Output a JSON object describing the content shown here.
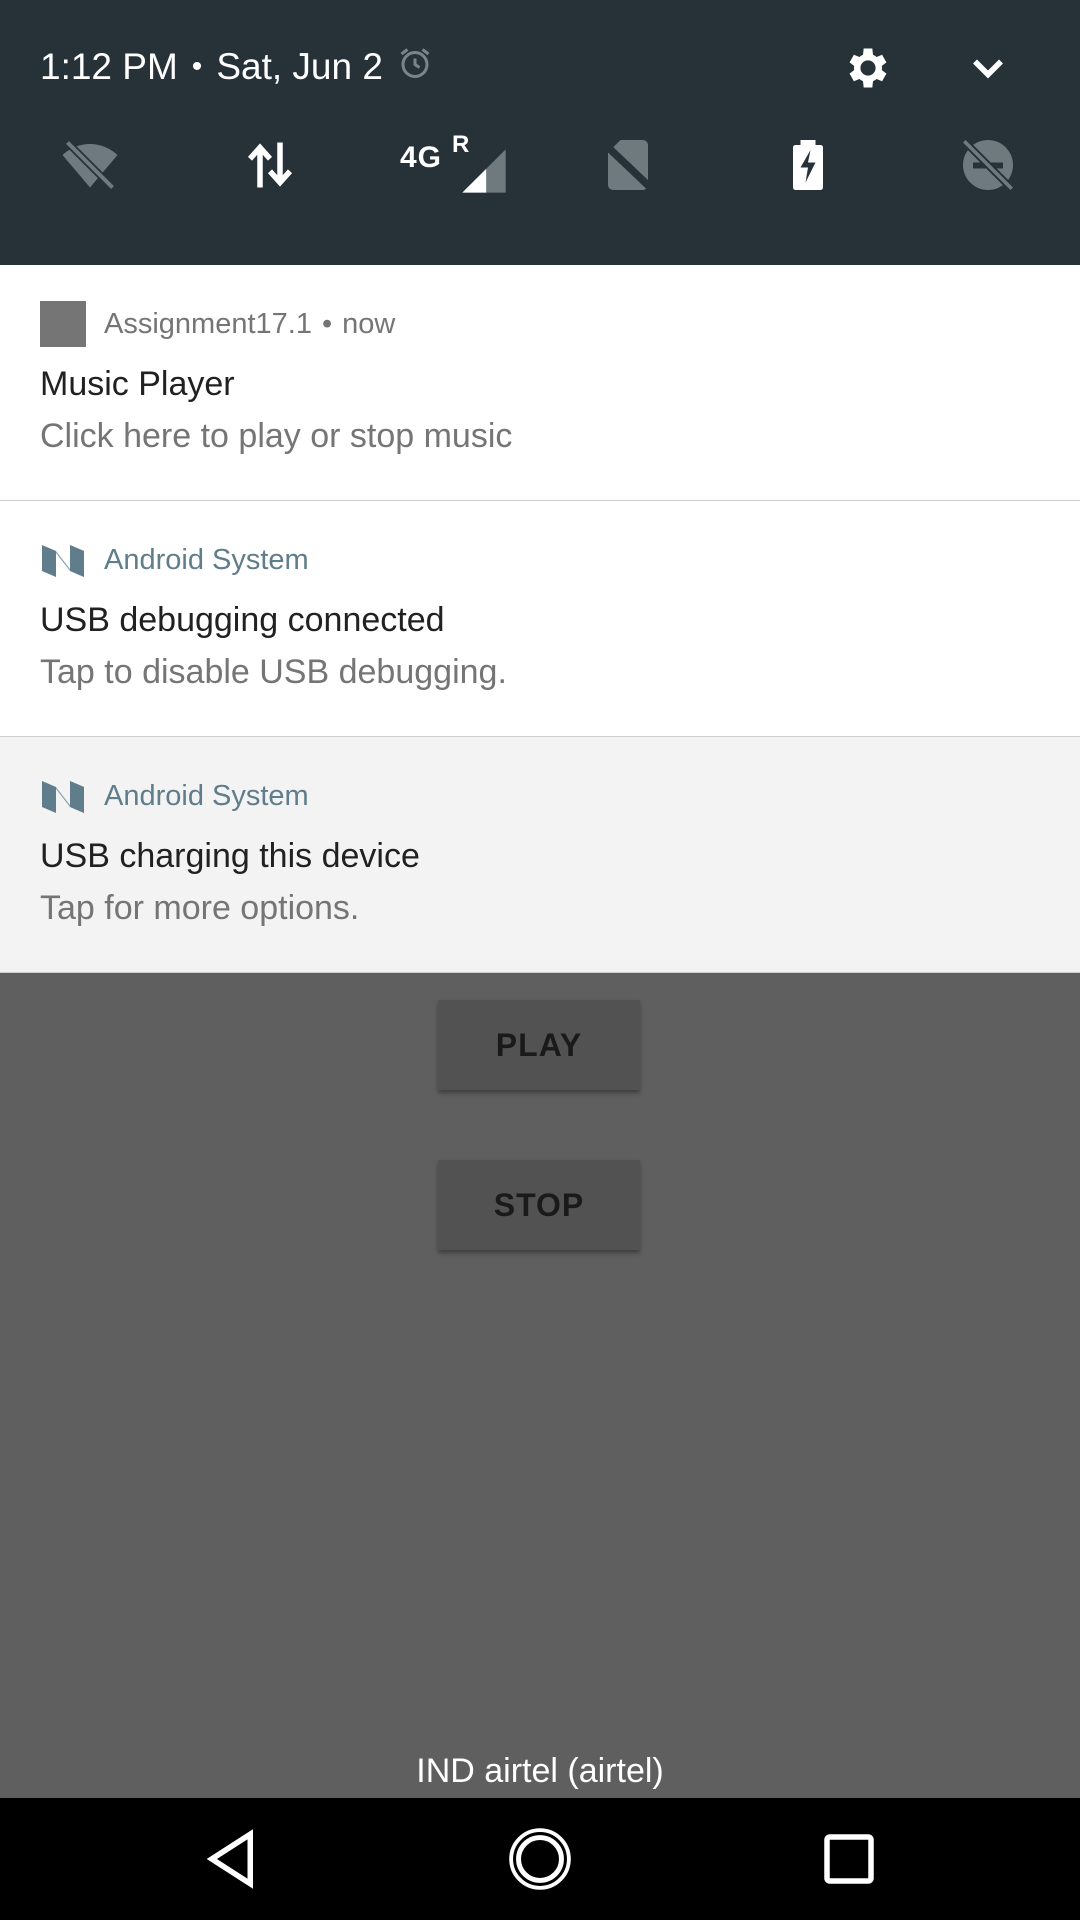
{
  "status": {
    "time": "1:12 PM",
    "separator": "•",
    "date": "Sat, Jun 2",
    "network_label": "4G",
    "roaming_label": "R"
  },
  "notifications": [
    {
      "app": "Assignment17.1",
      "separator": "•",
      "when": "now",
      "title": "Music Player",
      "text": "Click here to play or stop music"
    },
    {
      "app": "Android System",
      "title": "USB debugging connected",
      "text": "Tap to disable USB debugging."
    },
    {
      "app": "Android System",
      "title": "USB charging this device",
      "text": "Tap for more options."
    }
  ],
  "app": {
    "play_label": "PLAY",
    "stop_label": "STOP",
    "carrier": "IND airtel (airtel)"
  },
  "icons": {
    "alarm": "alarm-clock-icon",
    "settings": "gear-icon",
    "expand": "chevron-down-icon",
    "wifi": "wifi-off-icon",
    "data": "data-arrows-icon",
    "signal": "cell-signal-icon",
    "sim": "no-sim-icon",
    "battery": "battery-charging-icon",
    "dnd": "do-not-disturb-off-icon",
    "nav_back": "back-triangle-icon",
    "nav_home": "home-circle-icon",
    "nav_recents": "recents-square-icon"
  },
  "colors": {
    "header_bg": "#263238",
    "system_app_name": "#607d8b",
    "dimmed_app_bg": "#5f5f5f"
  }
}
